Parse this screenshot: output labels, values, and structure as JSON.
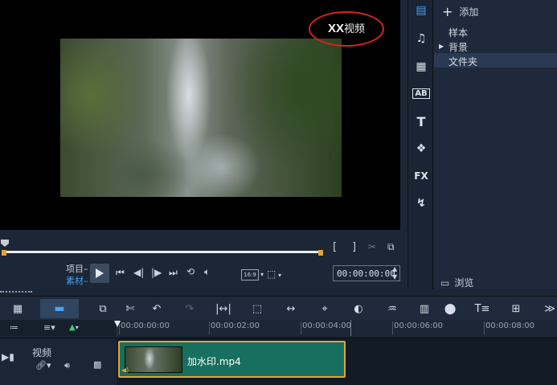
{
  "preview": {
    "watermark_text_bold": "XX",
    "watermark_text": "视频",
    "project_label": "项目",
    "clip_label": "素材",
    "timecode": "00:00:00:00",
    "aspect_label": "16:9"
  },
  "library": {
    "add_label": "添加",
    "tree": [
      "样本",
      "背景",
      "文件夹"
    ],
    "selected": "文件夹",
    "browse_label": "浏览",
    "toolbar_icons": [
      "media-icon",
      "music-icon",
      "instant-project-icon",
      "title-templates-icon",
      "text-icon",
      "graphics-icon",
      "fx-icon",
      "transition-icon"
    ]
  },
  "timeline": {
    "ruler_ticks": [
      "00:00:00:00",
      "00:00:02:00",
      "00:00:04:00",
      "00:00:06:00",
      "00:00:08:00"
    ],
    "track_name": "视频",
    "clip_name": "加水印.mp4"
  },
  "colors": {
    "accent_blue": "#4aa3f5",
    "clip_green": "#17705f",
    "trim_orange": "#e2a437",
    "annotation_red": "#d8231f"
  }
}
